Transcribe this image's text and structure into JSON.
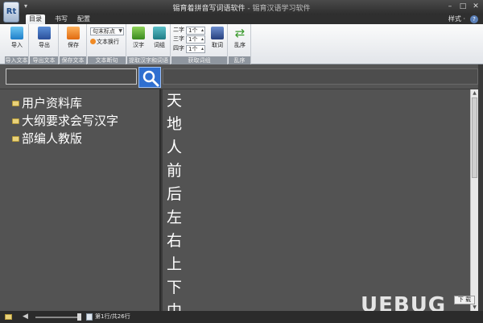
{
  "window": {
    "title": "锡育着拼音写词语软件",
    "subtitle": "- 锡育汉语学习软件",
    "min": "–",
    "max": "□",
    "close": "✕",
    "app_icon_text": "Rt"
  },
  "tabs": [
    {
      "label": "目录",
      "active": true
    },
    {
      "label": "书写",
      "active": false
    },
    {
      "label": "配置",
      "active": false
    }
  ],
  "style_menu": "样式 ·",
  "ribbon": {
    "groups": [
      {
        "label": "导入文本",
        "buttons": [
          {
            "label": "导入",
            "icon": "import-icon"
          }
        ]
      },
      {
        "label": "导出文本",
        "buttons": [
          {
            "label": "导出",
            "icon": "export-icon"
          }
        ]
      },
      {
        "label": "保存文本",
        "buttons": [
          {
            "label": "保存",
            "icon": "save-icon"
          }
        ]
      },
      {
        "label": "文本断句",
        "select": "句末标点",
        "wrap": "文本换行"
      },
      {
        "label": "提取汉字和词语",
        "buttons": [
          {
            "label": "汉字",
            "icon": "hanzi-icon"
          },
          {
            "label": "词组",
            "icon": "ciyu-icon"
          }
        ]
      },
      {
        "label": "获取词组",
        "rows": [
          {
            "label": "二字",
            "value": "1个"
          },
          {
            "label": "三字",
            "value": "1个"
          },
          {
            "label": "四字",
            "value": "1个"
          }
        ],
        "button": "取词"
      },
      {
        "label": "乱序",
        "buttons": [
          {
            "label": "乱序",
            "icon": "shuffle-icon"
          }
        ]
      }
    ]
  },
  "search": {
    "value": ""
  },
  "tree": [
    "用户资料库",
    "大纲要求会写汉字",
    "部编人教版"
  ],
  "chars": [
    "天",
    "地",
    "人",
    "前",
    "后",
    "左",
    "右",
    "上",
    "下",
    "中"
  ],
  "status": {
    "text": "第1行/共26行"
  },
  "badge": "下 载",
  "watermark": "UEBUG"
}
